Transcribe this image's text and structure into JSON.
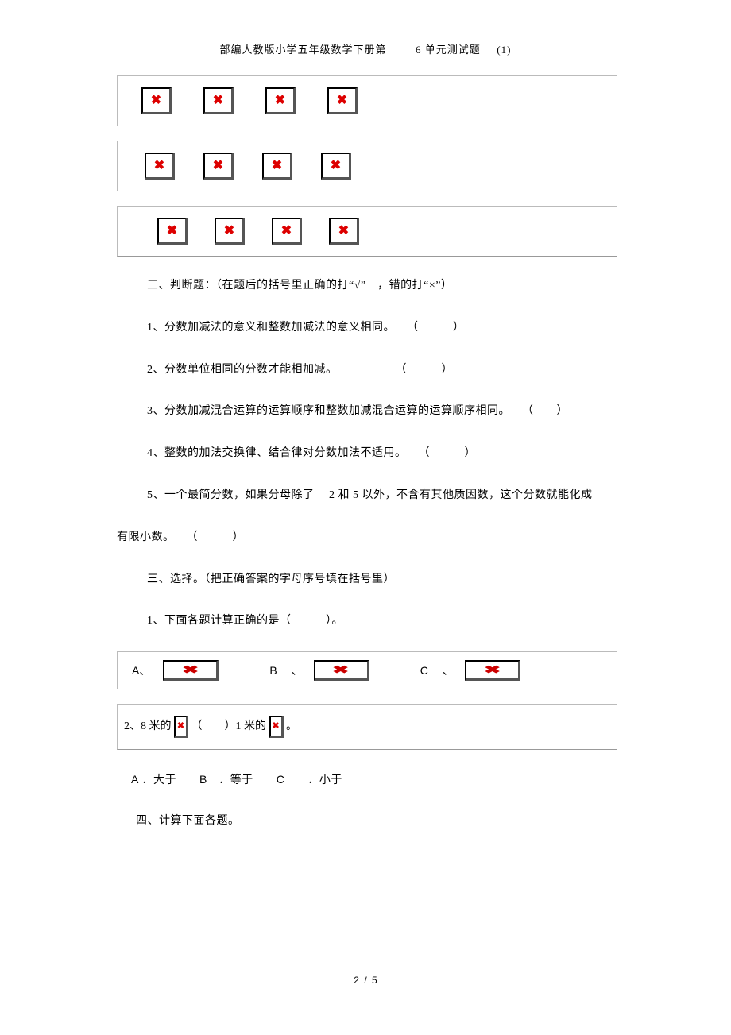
{
  "header": {
    "title_a": "部编人教版小学五年级数学下册第",
    "title_b": "6 单元测试题",
    "title_c": "(1)"
  },
  "sections": {
    "s3_heading": "三、判断题：（在题后的括号里正确的打“√”　，错的打“×”）",
    "s3_q1": "1、分数加减法的意义和整数加减法的意义相同。　　（　　　）",
    "s3_q2": "2、分数单位相同的分数才能相加减。　　　　　　（　　　）",
    "s3_q3": "3、分数加减混合运算的运算顺序和整数加减混合运算的运算顺序相同。　　（　　）",
    "s3_q4": "4、整数的加法交换律、结合律对分数加法不适用。　　（　　　）",
    "s3_q5a": "5、一个最简分数，如果分母除了　 2 和 5 以外，不含有其他质因数，这个分数就能化成",
    "s3_q5b": "有限小数。　　（　　　）",
    "s3b_heading": "三、选择。（把正确答案的字母序号填在括号里）",
    "s3b_q1": "1、下面各题计算正确的是（　　　）。",
    "opt_A": "A、",
    "opt_B": "B",
    "opt_C": "C",
    "punct_dn": "、",
    "q2_pre": "2、8 米的",
    "q2_mid": "（　　）1 米的",
    "q2_end": "。",
    "q2_opts": "A ．大于　　B　．等于　　C　　．小于",
    "s4_heading": "四、计算下面各题。"
  },
  "footer": {
    "page": "2",
    "slash": "/",
    "total": "5"
  }
}
